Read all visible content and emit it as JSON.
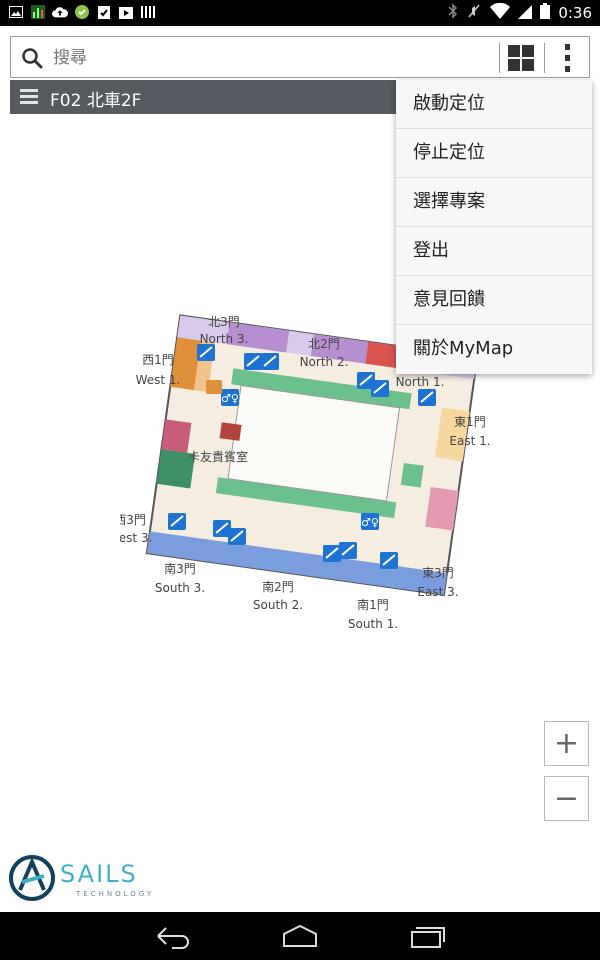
{
  "status_bar": {
    "time": "0:36",
    "left_icons": [
      "image-icon",
      "equalizer-icon",
      "cloud-upload-icon",
      "security-shield-icon",
      "clipboard-check-icon",
      "play-store-icon",
      "barcode-icon"
    ],
    "right_icons": [
      "bluetooth-icon",
      "mute-icon",
      "wifi-icon",
      "signal-icon",
      "battery-icon"
    ]
  },
  "search": {
    "placeholder": "搜尋"
  },
  "floor": {
    "label": "F02 北車2F"
  },
  "menu": {
    "items": [
      "啟動定位",
      "停止定位",
      "選擇專案",
      "登出",
      "意見回饋",
      "關於MyMap"
    ]
  },
  "map": {
    "labels": {
      "north3_zh": "北3門",
      "north3_en": "North 3.",
      "north2_zh": "北2門",
      "north2_en": "North 2.",
      "north1_en": "North 1.",
      "west1_zh": "西1門",
      "west1_en": "West 1.",
      "east1_zh": "東1門",
      "east1_en": "East 1.",
      "west3_zh": "西3門",
      "west3_en": "West 3.",
      "south3_zh": "南3門",
      "south3_en": "South 3.",
      "south2_zh": "南2門",
      "south2_en": "South 2.",
      "south1_zh": "南1門",
      "south1_en": "South 1.",
      "east3_zh": "東3門",
      "east3_en": "East 3.",
      "lounge": "卡友貴賓室"
    }
  },
  "zoom": {
    "in": "+",
    "out": "−"
  },
  "logo": {
    "brand": "SAILS",
    "sub": "TECHNOLOGY"
  },
  "colors": {
    "accent": "#1e73d2",
    "floorbar": "#555b60",
    "menu_bg": "#f7f7f7",
    "green": "#6cc08c",
    "purple": "#b78fd1",
    "blue": "#7a9ddd",
    "orange": "#e0903a",
    "pink": "#e49ab0"
  }
}
